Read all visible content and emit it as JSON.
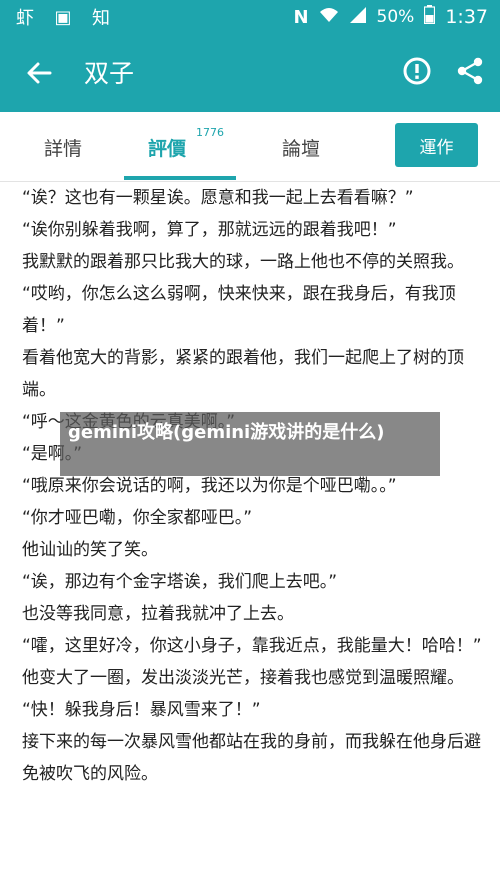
{
  "status_bar": {
    "left_icons": [
      "shrimp-notification-icon",
      "image-icon",
      "zhihu-icon"
    ],
    "left_glyphs": [
      "虾",
      "▣",
      "知"
    ],
    "nfc": "N",
    "battery": "50%",
    "time": "1:37"
  },
  "app_bar": {
    "title": "双子"
  },
  "tabs": {
    "items": [
      {
        "label": "詳情"
      },
      {
        "label": "評價",
        "badge": "1776"
      },
      {
        "label": "論壇"
      }
    ],
    "action_label": "運作"
  },
  "content": {
    "paragraphs": [
      "“诶？这也有一颗星诶。愿意和我一起上去看看嘛？”",
      "“诶你别躲着我啊，算了，那就远远的跟着我吧！”",
      "我默默的跟着那只比我大的球，一路上他也不停的关照我。",
      "“哎哟，你怎么这么弱啊，快来快来，跟在我身后，有我顶着！”",
      "看着他宽大的背影，紧紧的跟着他，我们一起爬上了树的顶端。",
      "“呼～这金黄色的云真美啊。”",
      "“是啊。”",
      "“哦原来你会说话的啊，我还以为你是个哑巴嘞。。”",
      "“你才哑巴嘞，你全家都哑巴。”",
      "他讪讪的笑了笑。",
      "“诶，那边有个金字塔诶，我们爬上去吧。”",
      "也没等我同意，拉着我就冲了上去。",
      "“嚯，这里好冷，你这小身子，靠我近点，我能量大！哈哈！”",
      "他变大了一圈，发出淡淡光芒，接着我也感觉到温暖照耀。",
      "“快！躲我身后！暴风雪来了！”",
      "接下来的每一次暴风雪他都站在我的身前，而我躲在他身后避免被吹飞的风险。"
    ]
  },
  "banner": {
    "text": "gemini攻略(gemini游戏讲的是什么)"
  },
  "colors": {
    "primary": "#1ea5ad",
    "text": "#222222",
    "banner_bg": "rgba(90,90,90,0.72)"
  }
}
